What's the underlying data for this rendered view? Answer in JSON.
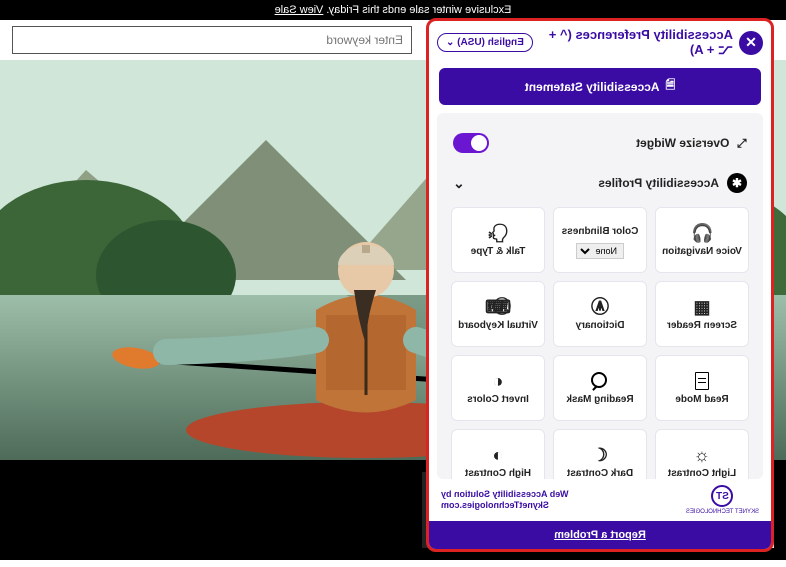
{
  "banner": {
    "text": "Exclusive winter sale ends this Friday. ",
    "cta": "View Sale"
  },
  "search": {
    "placeholder": "Enter keyword"
  },
  "widget": {
    "title": "Accessibility Preferences  (^ + ⌥ + A)",
    "language": "English (USA) ⌄",
    "statement": "Accessibility Statement",
    "oversize": {
      "label": "Oversize Widget",
      "on": true
    },
    "profiles": {
      "label": "Accessibility Profiles"
    },
    "tiles": [
      {
        "id": "voice-navigation",
        "label": "Voice Navigation",
        "icon": "🎧"
      },
      {
        "id": "color-blindness",
        "label": "Color Blindness",
        "icon": "",
        "select": "None"
      },
      {
        "id": "talk-type",
        "label": "Talk & Type",
        "icon": "🗣"
      },
      {
        "id": "screen-reader",
        "label": "Screen Reader",
        "icon": "▦"
      },
      {
        "id": "dictionary",
        "label": "Dictionary",
        "icon": "Ⓐ"
      },
      {
        "id": "virtual-keyboard",
        "label": "Virtual Keyboard",
        "icon": "⌨"
      },
      {
        "id": "read-mode",
        "label": "Read Mode",
        "icon": "doc"
      },
      {
        "id": "reading-mask",
        "label": "Reading Mask",
        "icon": "mask"
      },
      {
        "id": "invert-colors",
        "label": "Invert Colors",
        "icon": "◐"
      },
      {
        "id": "light-contrast",
        "label": "Light Contrast",
        "icon": "☼"
      },
      {
        "id": "dark-contrast",
        "label": "Dark Contrast",
        "icon": "☾"
      },
      {
        "id": "high-contrast",
        "label": "High Contrast",
        "icon": "◑"
      }
    ],
    "credit": {
      "line1": "Web Accessibility Solution by",
      "line2": "SkynetTechnologies.com",
      "logo_text": "ST",
      "logo_sub": "SKYNET TECHNOLOGIES"
    },
    "report": "Report a Problem"
  }
}
